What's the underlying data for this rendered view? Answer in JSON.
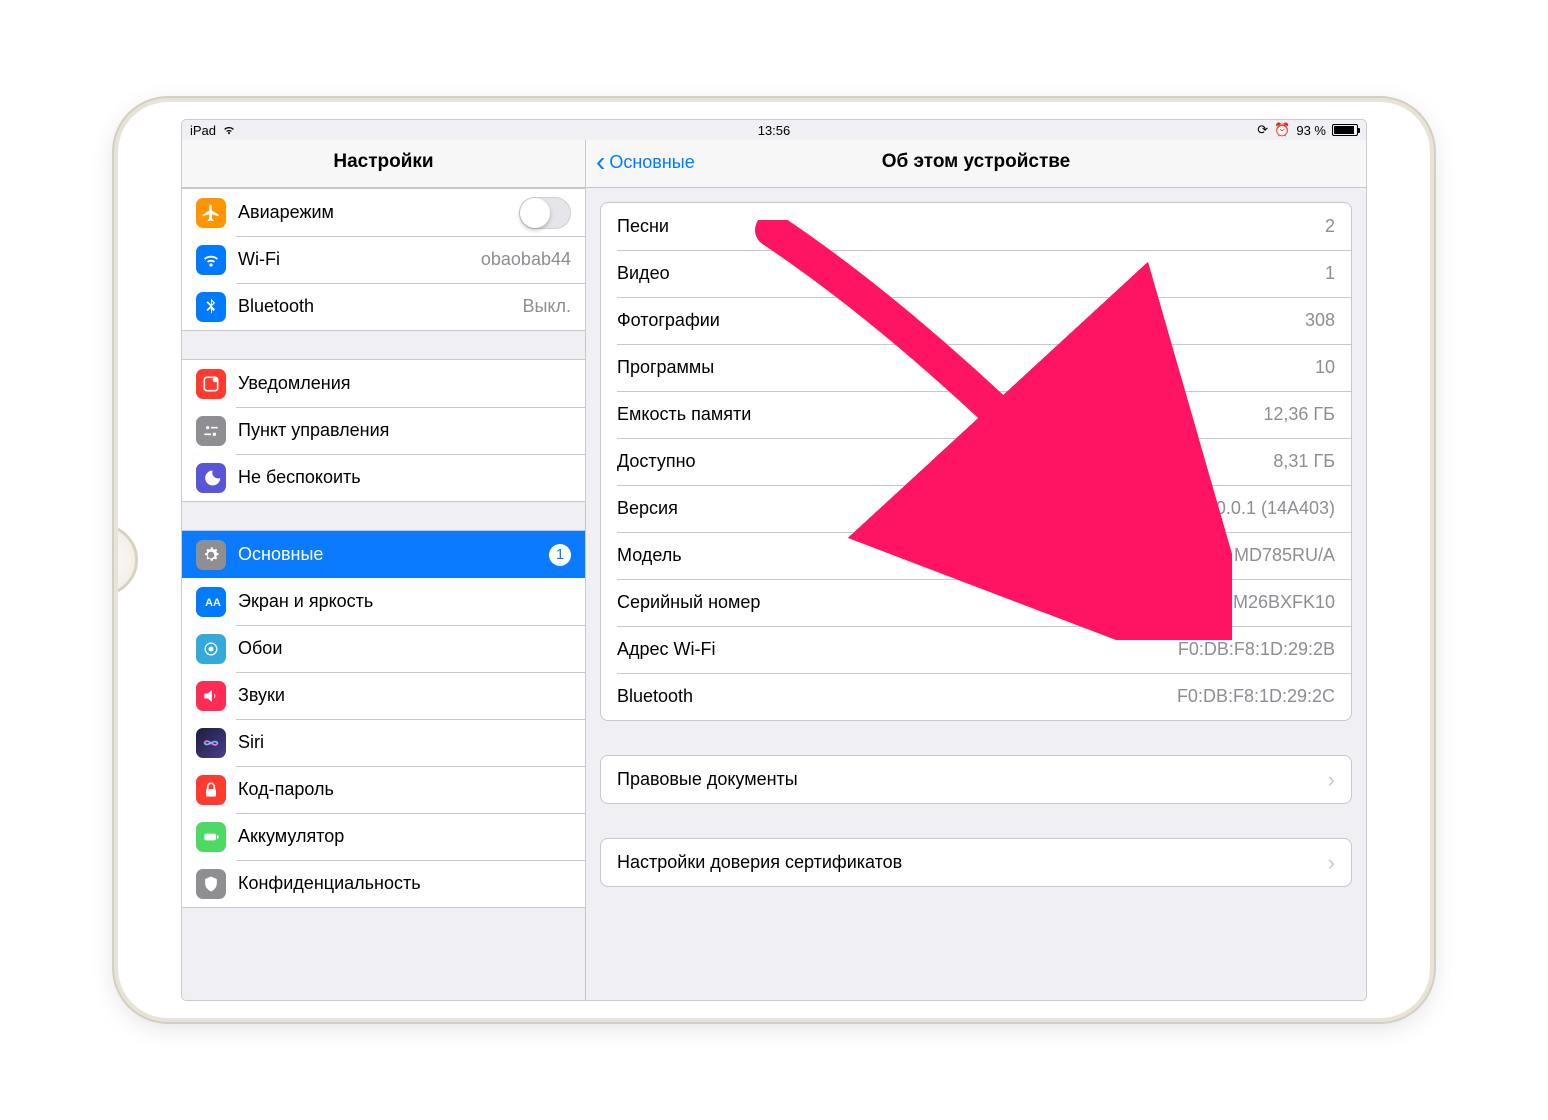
{
  "status": {
    "device": "iPad",
    "time": "13:56",
    "battery": "93 %"
  },
  "sidebar": {
    "title": "Настройки",
    "airplane": {
      "label": "Авиарежим"
    },
    "wifi": {
      "label": "Wi-Fi",
      "value": "obaobab44"
    },
    "bluetooth": {
      "label": "Bluetooth",
      "value": "Выкл."
    },
    "notifications": {
      "label": "Уведомления"
    },
    "controlCenter": {
      "label": "Пункт управления"
    },
    "dnd": {
      "label": "Не беспокоить"
    },
    "general": {
      "label": "Основные",
      "badge": "1"
    },
    "display": {
      "label": "Экран и яркость"
    },
    "wallpaper": {
      "label": "Обои"
    },
    "sounds": {
      "label": "Звуки"
    },
    "siri": {
      "label": "Siri"
    },
    "passcode": {
      "label": "Код-пароль"
    },
    "battery": {
      "label": "Аккумулятор"
    },
    "privacy": {
      "label": "Конфиденциальность"
    }
  },
  "detail": {
    "back": "Основные",
    "title": "Об этом устройстве",
    "songs": {
      "k": "Песни",
      "v": "2"
    },
    "videos": {
      "k": "Видео",
      "v": "1"
    },
    "photos": {
      "k": "Фотографии",
      "v": "308"
    },
    "apps": {
      "k": "Программы",
      "v": "10"
    },
    "capacity": {
      "k": "Емкость памяти",
      "v": "12,36 ГБ"
    },
    "available": {
      "k": "Доступно",
      "v": "8,31 ГБ"
    },
    "version": {
      "k": "Версия",
      "v": "10.0.1 (14A403)"
    },
    "model": {
      "k": "Модель",
      "v": "MD785RU/A"
    },
    "serial": {
      "k": "Серийный номер",
      "v": "DMQM26BXFK10"
    },
    "wifiAddr": {
      "k": "Адрес Wi-Fi",
      "v": "F0:DB:F8:1D:29:2B"
    },
    "btAddr": {
      "k": "Bluetooth",
      "v": "F0:DB:F8:1D:29:2C"
    },
    "legal": {
      "k": "Правовые документы"
    },
    "cert": {
      "k": "Настройки доверия сертификатов"
    }
  }
}
